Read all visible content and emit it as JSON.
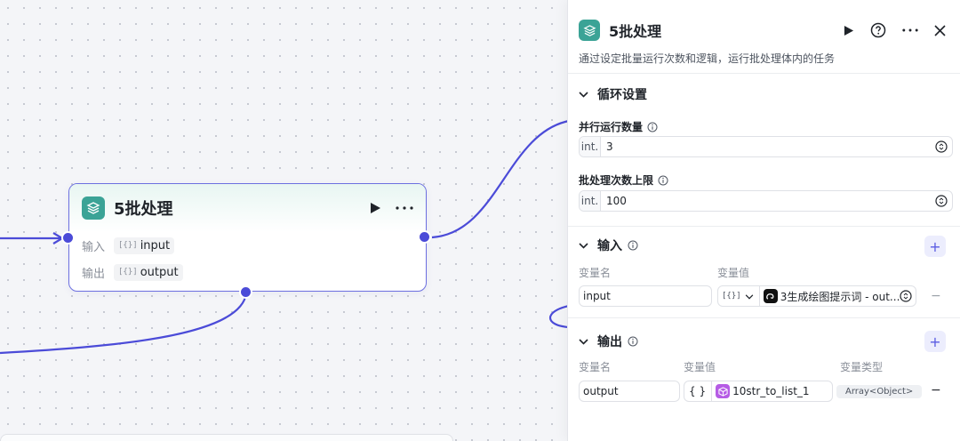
{
  "node": {
    "title": "5批处理",
    "input_label": "输入",
    "input_value": "input",
    "output_label": "输出",
    "output_value": "output",
    "bracket": "[{}]"
  },
  "panel": {
    "title": "5批处理",
    "description": "通过设定批量运行次数和逻辑，运行批处理体内的任务",
    "loop_section": {
      "title": "循环设置",
      "parallel_label": "并行运行数量",
      "parallel_prefix": "int.",
      "parallel_value": "3",
      "limit_label": "批处理次数上限",
      "limit_prefix": "int.",
      "limit_value": "100"
    },
    "input_section": {
      "title": "输入",
      "add": "+",
      "col_name": "变量名",
      "col_value": "变量值",
      "row_name": "input",
      "row_type_prefix": "[{}]",
      "row_ref": "3生成绘图提示词 - out...",
      "remove": "−"
    },
    "output_section": {
      "title": "输出",
      "add": "+",
      "col_name": "变量名",
      "col_value": "变量值",
      "col_type": "变量类型",
      "row_name": "output",
      "row_brace": "{ }",
      "row_ref": "10str_to_list_1",
      "row_type": "Array<Object>",
      "remove": "−"
    }
  },
  "colors": {
    "accent": "#4b4bd8",
    "node_logo": "#3ba396",
    "ref_icon_purple": "#b65ce5"
  },
  "icons": [
    "layers-icon",
    "play-icon",
    "more-icon",
    "help-icon",
    "close-icon",
    "chevron-down-icon",
    "info-icon",
    "stepper-icon",
    "model-icon",
    "cube-icon"
  ]
}
